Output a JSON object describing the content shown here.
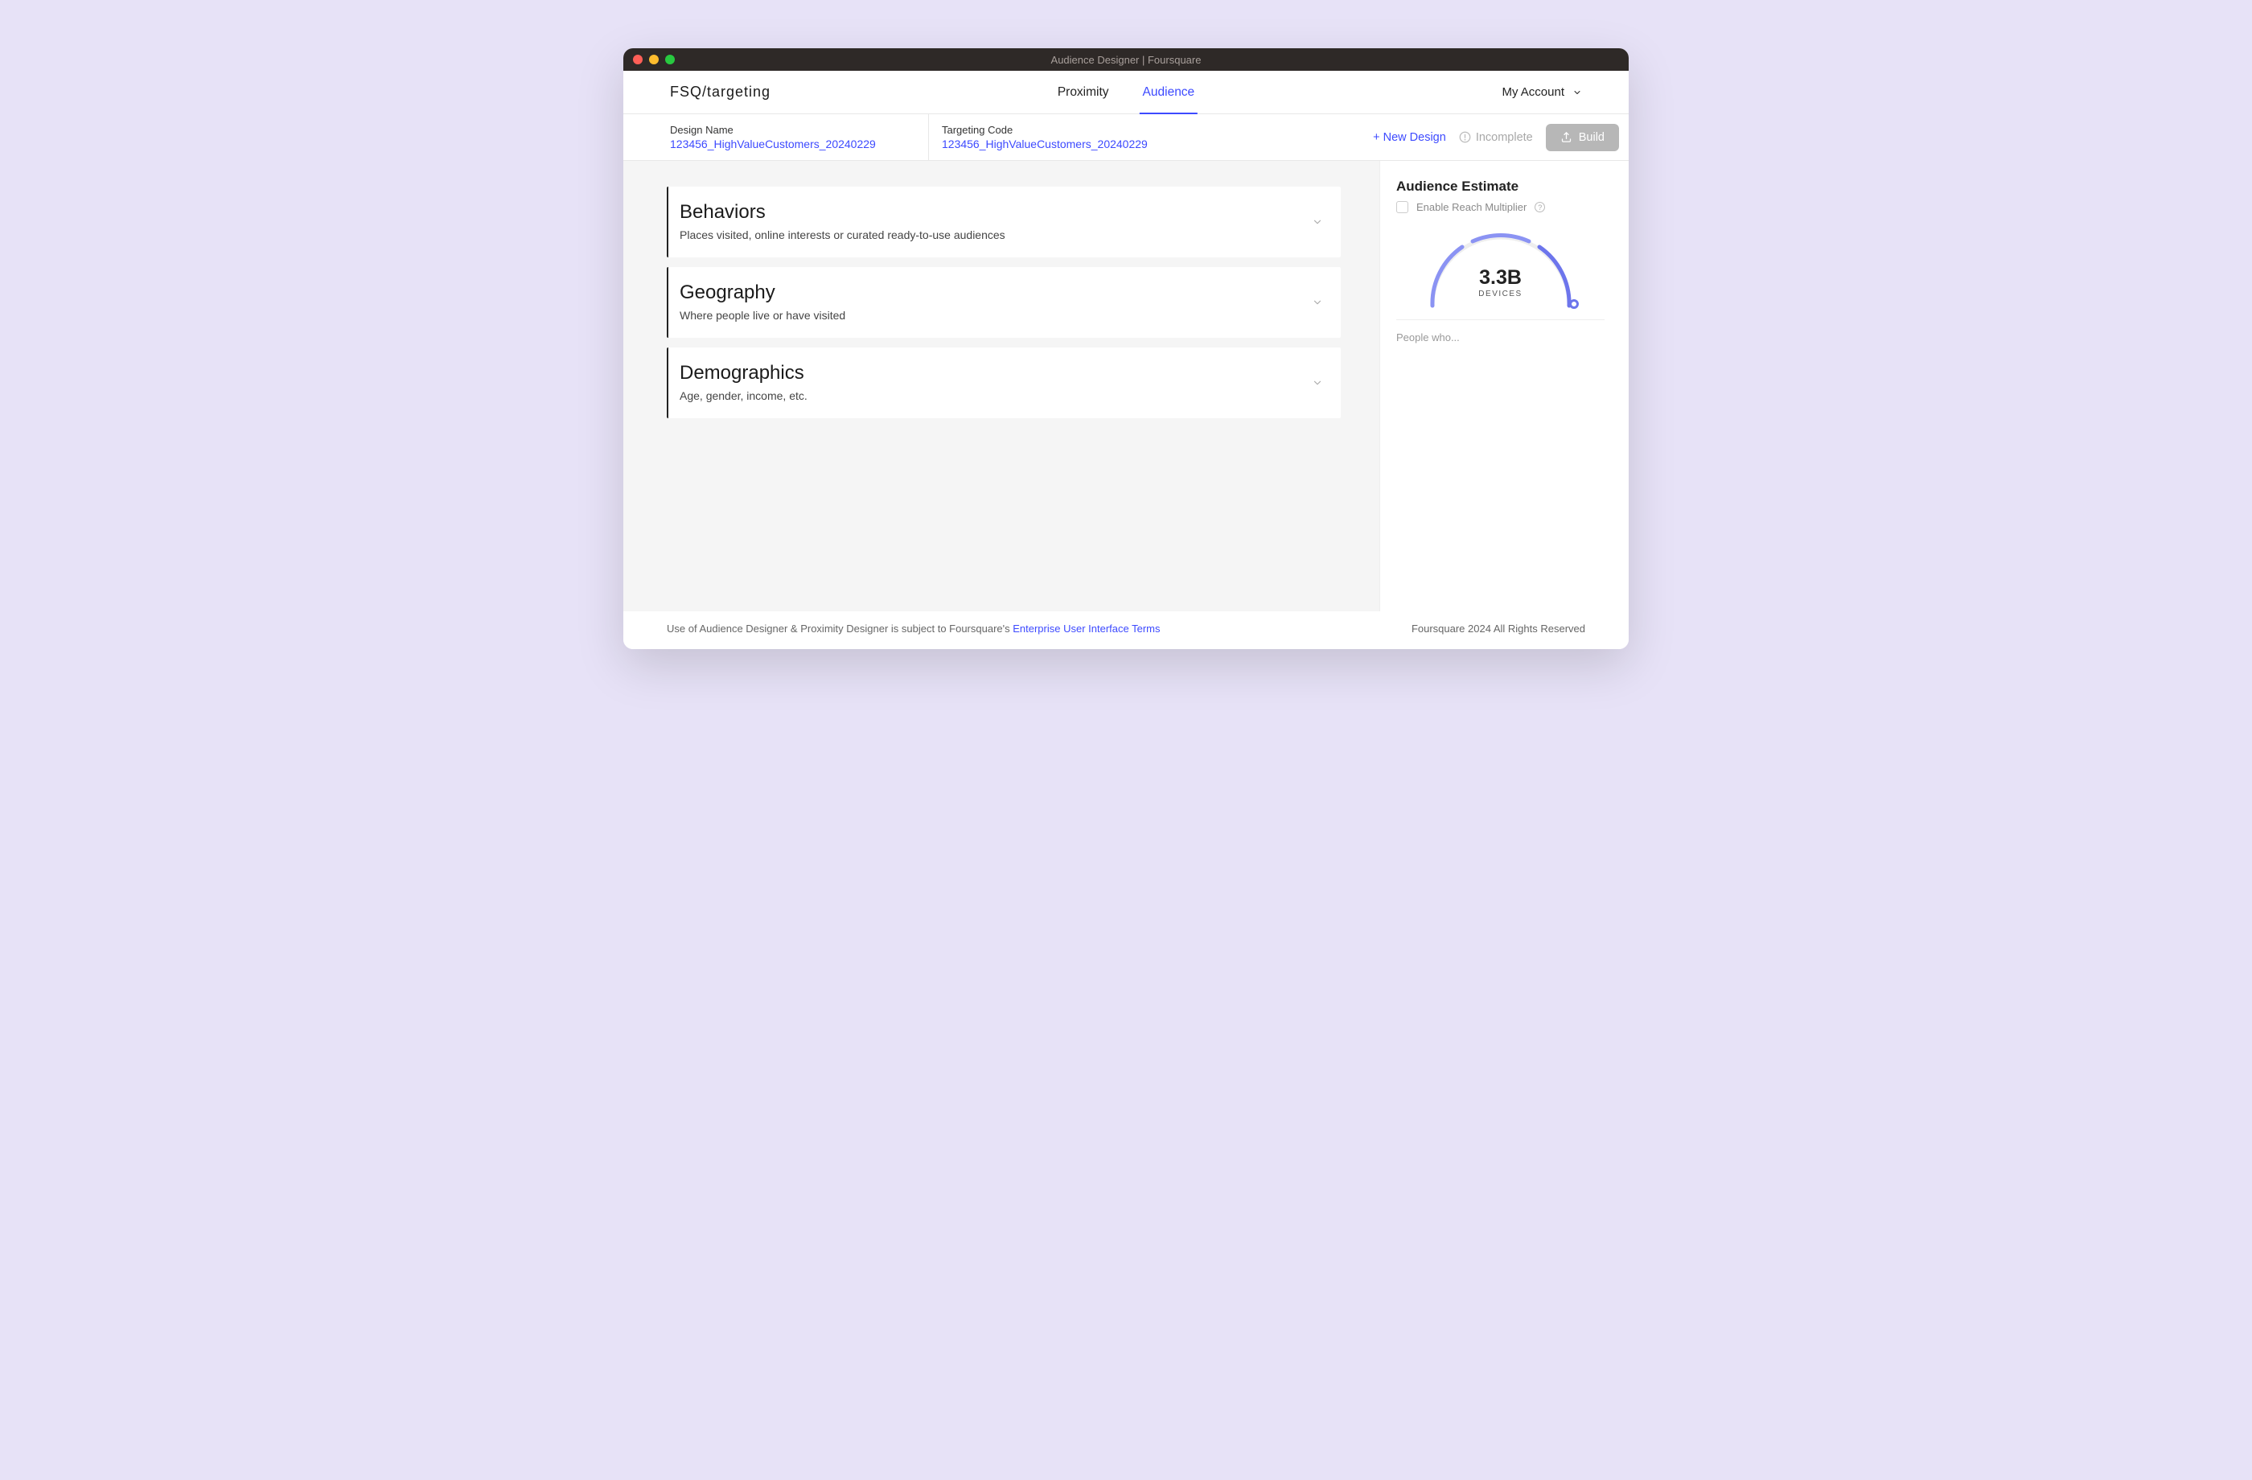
{
  "window": {
    "title": "Audience Designer | Foursquare"
  },
  "header": {
    "logo_prefix": "FSQ",
    "logo_suffix": "/targeting",
    "tabs": [
      {
        "label": "Proximity",
        "active": false
      },
      {
        "label": "Audience",
        "active": true
      }
    ],
    "account_label": "My Account"
  },
  "subheader": {
    "design_name_label": "Design Name",
    "design_name_value": "123456_HighValueCustomers_20240229",
    "targeting_code_label": "Targeting Code",
    "targeting_code_value": "123456_HighValueCustomers_20240229",
    "new_design_label": "+ New Design",
    "status_label": "Incomplete",
    "build_label": "Build"
  },
  "cards": [
    {
      "title": "Behaviors",
      "desc": "Places visited, online interests or curated ready-to-use audiences"
    },
    {
      "title": "Geography",
      "desc": "Where people live or have visited"
    },
    {
      "title": "Demographics",
      "desc": "Age, gender, income, etc."
    }
  ],
  "estimate": {
    "title": "Audience Estimate",
    "reach_label": "Enable Reach Multiplier",
    "value": "3.3B",
    "unit": "DEVICES",
    "people_who": "People who..."
  },
  "footer": {
    "disclaimer_prefix": "Use of Audience Designer & Proximity Designer is subject to Foursquare's ",
    "terms_link": "Enterprise User Interface Terms",
    "copyright": "Foursquare 2024 All Rights Reserved"
  }
}
